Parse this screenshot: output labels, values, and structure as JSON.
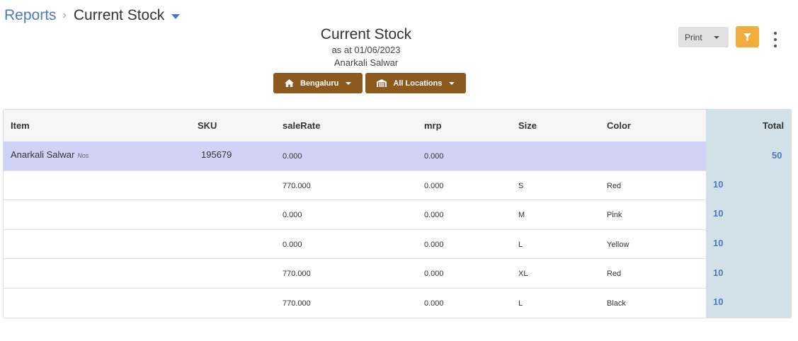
{
  "breadcrumb": {
    "link": "Reports",
    "separator": "›",
    "current": "Current Stock"
  },
  "report": {
    "title": "Current Stock",
    "date_line": "as at 01/06/2023",
    "item_line": "Anarkali Salwar"
  },
  "filters": {
    "city": "Bengaluru",
    "location": "All Locations"
  },
  "toolbar": {
    "print_label": "Print"
  },
  "colors": {
    "accent": "#4a7ac0",
    "brown": "#8c5a1f",
    "filter": "#f0ad3c",
    "parent_row": "#d0d3f5",
    "total_col": "#d2e1e8"
  },
  "table": {
    "headers": {
      "item": "Item",
      "sku": "SKU",
      "sale_rate": "saleRate",
      "mrp": "mrp",
      "size": "Size",
      "color": "Color",
      "total": "Total"
    },
    "parent": {
      "item": "Anarkali Salwar",
      "unit": "Nos",
      "sku": "195679",
      "sale_rate": "0.000",
      "mrp": "0.000",
      "total": "50"
    },
    "rows": [
      {
        "sale_rate": "770.000",
        "mrp": "0.000",
        "size": "S",
        "color": "Red",
        "total": "10"
      },
      {
        "sale_rate": "0.000",
        "mrp": "0.000",
        "size": "M",
        "color": "Pink",
        "total": "10"
      },
      {
        "sale_rate": "0.000",
        "mrp": "0.000",
        "size": "L",
        "color": "Yellow",
        "total": "10"
      },
      {
        "sale_rate": "770.000",
        "mrp": "0.000",
        "size": "XL",
        "color": "Red",
        "total": "10"
      },
      {
        "sale_rate": "770.000",
        "mrp": "0.000",
        "size": "L",
        "color": "Black",
        "total": "10"
      }
    ]
  }
}
